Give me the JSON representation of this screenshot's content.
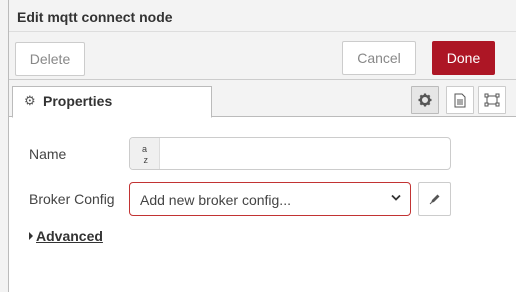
{
  "header": {
    "title": "Edit mqtt connect node"
  },
  "toolbar": {
    "delete_label": "Delete",
    "cancel_label": "Cancel",
    "done_label": "Done",
    "done_color": "#ad1625"
  },
  "tabs": [
    {
      "label": "Properties",
      "icon": "gear-icon"
    }
  ],
  "tab_buttons": [
    "gear-icon",
    "document-icon",
    "frame-icon"
  ],
  "form": {
    "name": {
      "label": "Name",
      "prefix": "a z",
      "value": ""
    },
    "broker": {
      "label": "Broker Config",
      "selected": "Add new broker config...",
      "invalid_color": "#c23333"
    },
    "advanced": {
      "label": "Advanced"
    }
  }
}
